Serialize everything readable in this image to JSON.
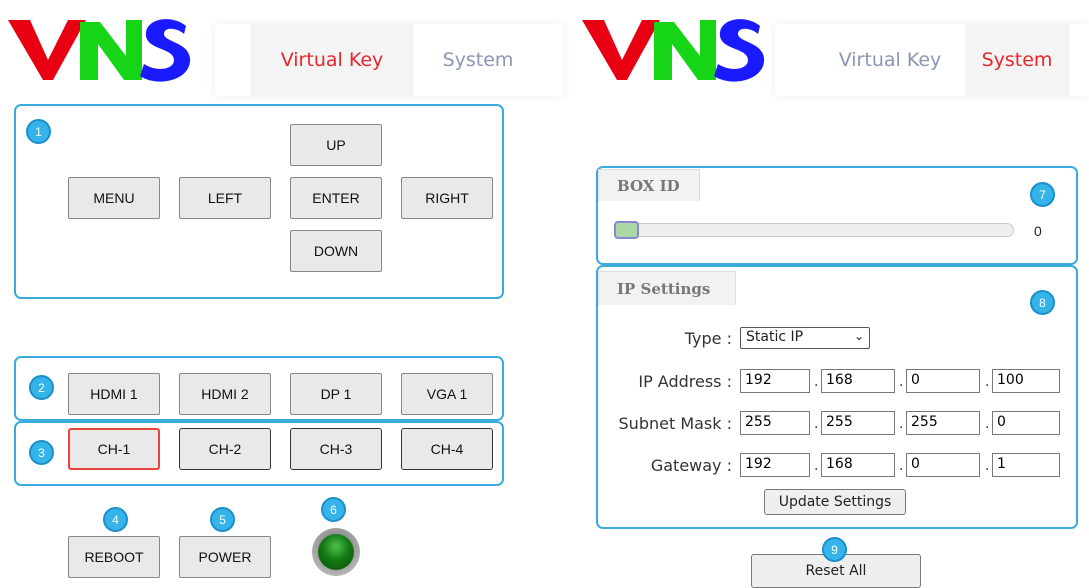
{
  "left": {
    "logo": "VNS",
    "tabs": [
      {
        "label": "Virtual Key"
      },
      {
        "label": "System"
      }
    ],
    "dpad": {
      "badge": "1",
      "up": "UP",
      "menu": "MENU",
      "left": "LEFT",
      "enter": "ENTER",
      "right": "RIGHT",
      "down": "DOWN"
    },
    "inputs": {
      "badge": "2",
      "buttons": [
        "HDMI 1",
        "HDMI 2",
        "DP 1",
        "VGA 1"
      ]
    },
    "channels": {
      "badge": "3",
      "buttons": [
        "CH-1",
        "CH-2",
        "CH-3",
        "CH-4"
      ],
      "selected": "CH-1"
    },
    "reboot": {
      "badge": "4",
      "label": "REBOOT"
    },
    "power": {
      "badge": "5",
      "label": "POWER"
    },
    "led": {
      "badge": "6",
      "color": "#1f7a1f"
    }
  },
  "right": {
    "logo": "VNS",
    "tabs": [
      {
        "label": "Virtual Key"
      },
      {
        "label": "System"
      }
    ],
    "box_id": {
      "title": "BOX ID",
      "badge": "7",
      "value": "0",
      "slider_fraction": 0
    },
    "ip": {
      "title": "IP Settings",
      "badge": "8",
      "type_label": "Type :",
      "type_value": "Static IP",
      "ip_label": "IP Address :",
      "ip": [
        "192",
        "168",
        "0",
        "100"
      ],
      "mask_label": "Subnet Mask :",
      "mask": [
        "255",
        "255",
        "255",
        "0"
      ],
      "gw_label": "Gateway :",
      "gw": [
        "192",
        "168",
        "0",
        "1"
      ],
      "update_label": "Update Settings"
    },
    "reset": {
      "badge": "9",
      "label": "Reset All"
    }
  },
  "colors": {
    "accent": "#e8262c",
    "panel_border": "#3aabdc",
    "badge": "#35b4ea",
    "logo_red": "#e80012",
    "logo_green": "#16d416",
    "logo_blue": "#1a1aff"
  }
}
